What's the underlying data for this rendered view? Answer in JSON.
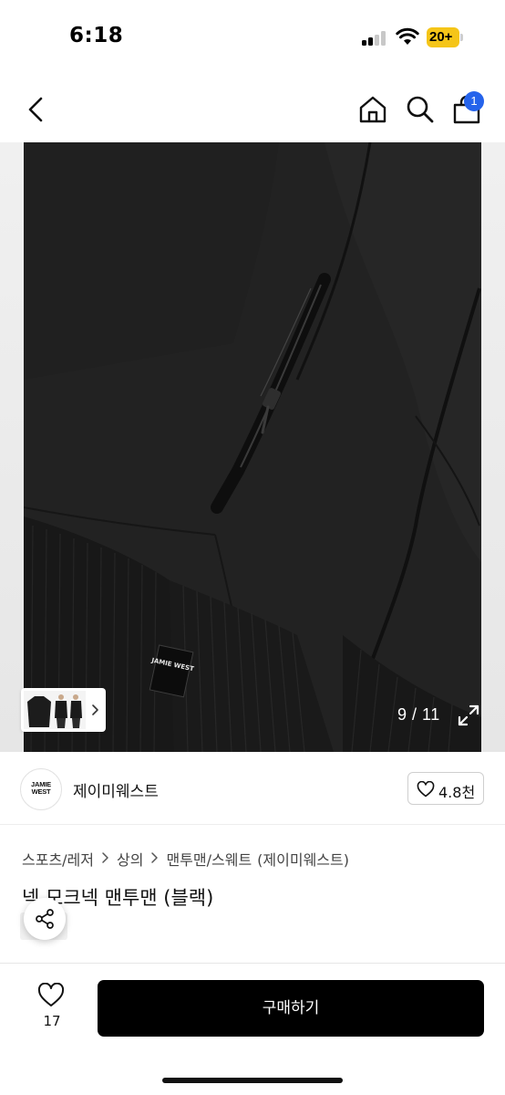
{
  "status_bar": {
    "time": "6:18",
    "battery": "20+",
    "icons": [
      "signal-icon",
      "wifi-icon",
      "battery-icon"
    ]
  },
  "header": {
    "icons": [
      "back-icon",
      "home-icon",
      "search-icon",
      "cart-icon"
    ],
    "cart_count": "1",
    "cart_badge_color": "#2563eb"
  },
  "gallery": {
    "page_counter": "9 / 11",
    "icons": [
      "expand-icon",
      "chevron-right-icon"
    ],
    "image_label": "JAMIE WEST"
  },
  "brand": {
    "logo_text": "JAMIE WEST",
    "name": "제이미웨스트",
    "like_count": "4.8천",
    "icons": [
      "heart-icon"
    ]
  },
  "breadcrumb": {
    "items": [
      "스포츠/레저",
      "상의",
      "맨투맨/스웨트"
    ],
    "brand_suffix": "(제이미웨스트)",
    "separator_icon": "chevron-right-icon"
  },
  "product": {
    "title": "넥 모크넥 맨투맨 (블랙)",
    "icons": [
      "share-icon"
    ]
  },
  "bottom_bar": {
    "wish_count": "17",
    "buy_label": "구매하기",
    "accent_color": "#000000",
    "icons": [
      "heart-icon"
    ]
  }
}
